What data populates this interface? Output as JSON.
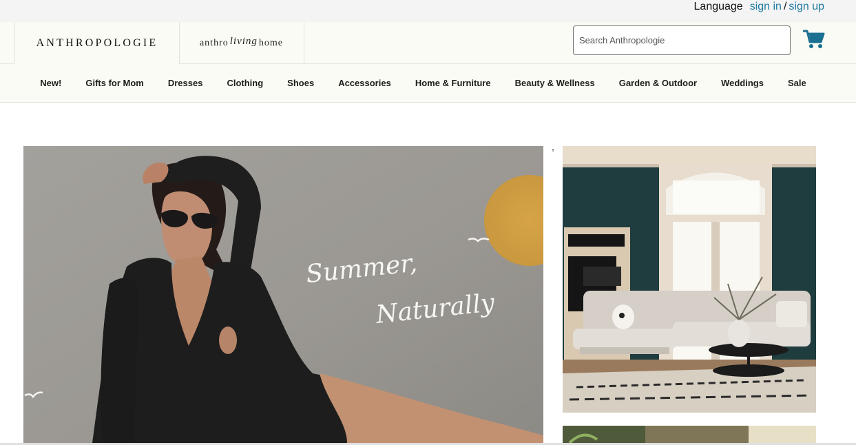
{
  "utility": {
    "language_label": "Language",
    "sign_in": "sign in",
    "separator": "/",
    "sign_up": "sign up"
  },
  "header": {
    "brand_main": "ANTHROPOLOGIE",
    "brand_home_left": "anthro",
    "brand_home_script": "living",
    "brand_home_right": "home",
    "search": {
      "placeholder": "Search Anthropologie",
      "value": ""
    },
    "cart_icon": "cart-icon"
  },
  "nav": {
    "items": [
      "New!",
      "Gifts for Mom",
      "Dresses",
      "Clothing",
      "Shoes",
      "Accessories",
      "Home & Furniture",
      "Beauty & Wellness",
      "Garden & Outdoor",
      "Weddings",
      "Sale"
    ]
  },
  "hero": {
    "line1": "Summer,",
    "line2": "Naturally",
    "stray_mark": ","
  },
  "colors": {
    "link": "#1f7aa3",
    "cart": "#1b6f91",
    "header_bg": "#fbfbf5",
    "utility_bg": "#f4f4f4"
  }
}
